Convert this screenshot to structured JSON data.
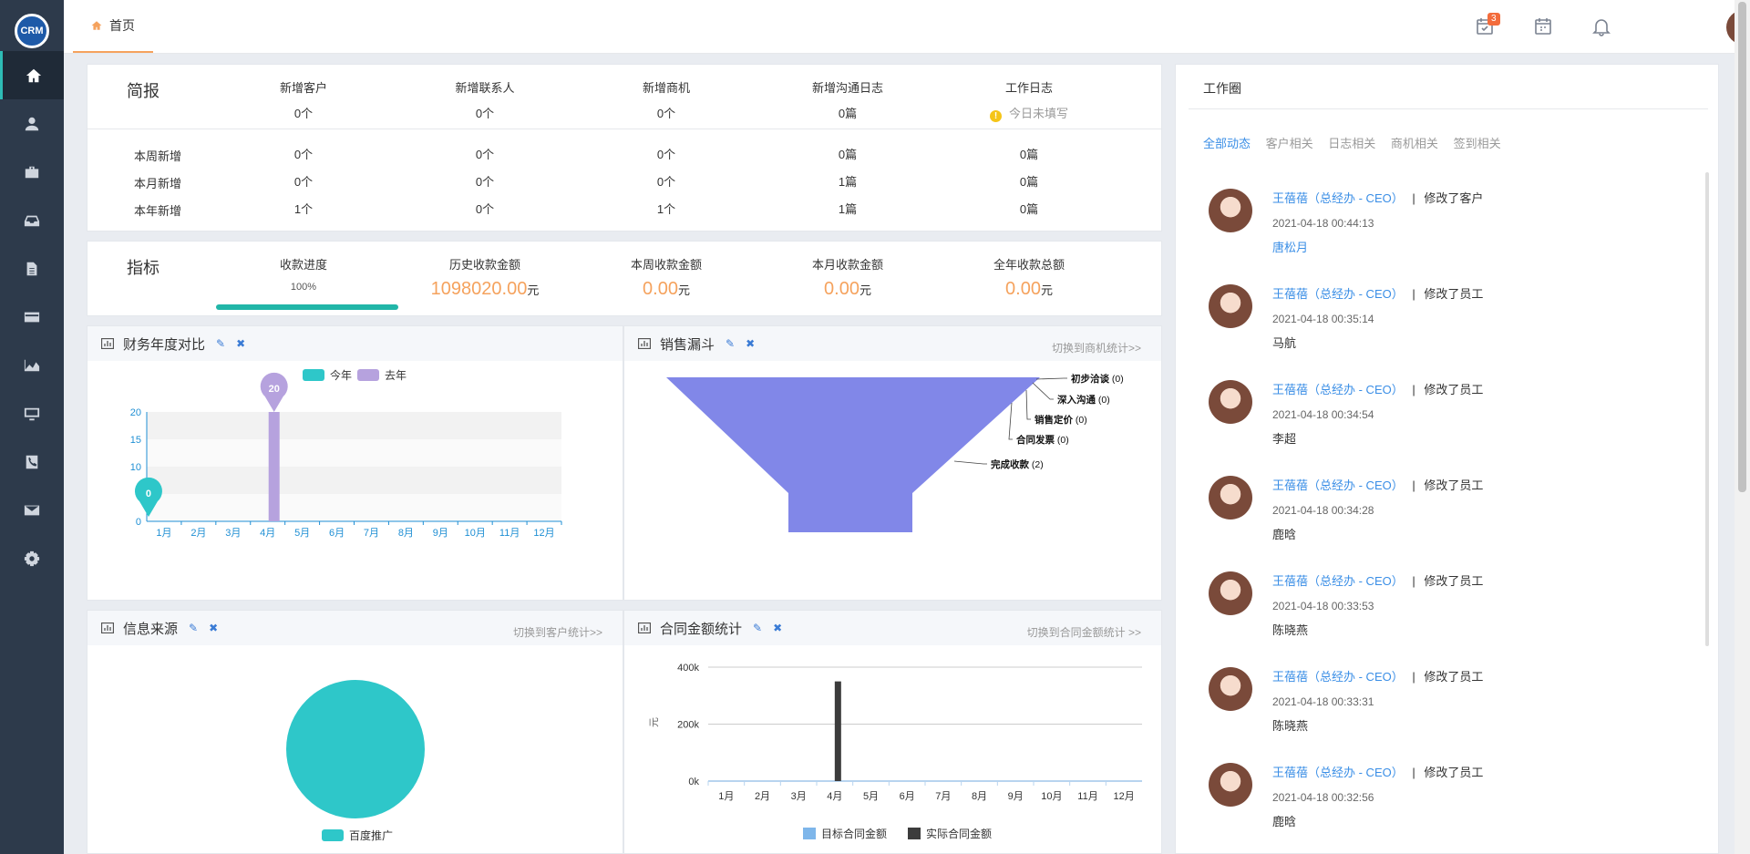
{
  "app": {
    "logo_text": "CRM"
  },
  "nav": {
    "items": [
      {
        "icon": "home-icon"
      },
      {
        "icon": "user-icon"
      },
      {
        "icon": "briefcase-icon"
      },
      {
        "icon": "inbox-icon"
      },
      {
        "icon": "document-icon"
      },
      {
        "icon": "card-icon"
      },
      {
        "icon": "area-chart-icon"
      },
      {
        "icon": "monitor-icon"
      },
      {
        "icon": "phone-icon"
      },
      {
        "icon": "mail-icon"
      },
      {
        "icon": "gear-icon"
      }
    ]
  },
  "topbar": {
    "tab_home": "首页",
    "task_badge": "3"
  },
  "summary": {
    "title": "简报",
    "headers": [
      "新增客户",
      "新增联系人",
      "新增商机",
      "新增沟通日志",
      "工作日志"
    ],
    "today": [
      "0个",
      "0个",
      "0个",
      "0篇"
    ],
    "today_worklog": "今日未填写",
    "rows": [
      {
        "label": "本周新增",
        "values": [
          "0个",
          "0个",
          "0个",
          "0篇",
          "0篇"
        ]
      },
      {
        "label": "本月新增",
        "values": [
          "0个",
          "0个",
          "0个",
          "1篇",
          "0篇"
        ]
      },
      {
        "label": "本年新增",
        "values": [
          "1个",
          "0个",
          "1个",
          "1篇",
          "0篇"
        ]
      }
    ]
  },
  "metrics": {
    "title": "指标",
    "progress_label": "收款进度",
    "progress_text": "100%",
    "progress_value": 1.0,
    "items": [
      {
        "label": "历史收款金额",
        "value": "1098020.00",
        "unit": "元"
      },
      {
        "label": "本周收款金额",
        "value": "0.00",
        "unit": "元"
      },
      {
        "label": "本月收款金额",
        "value": "0.00",
        "unit": "元"
      },
      {
        "label": "全年收款总额",
        "value": "0.00",
        "unit": "元"
      }
    ]
  },
  "finance_chart": {
    "title": "财务年度对比",
    "edit": "✎",
    "close": "✖"
  },
  "funnel_chart": {
    "title": "销售漏斗",
    "edit": "✎",
    "close": "✖",
    "switch": "切换到商机统计>>"
  },
  "source_chart": {
    "title": "信息来源",
    "edit": "✎",
    "close": "✖",
    "switch": "切换到客户统计>>"
  },
  "contract_chart": {
    "title": "合同金额统计",
    "edit": "✎",
    "close": "✖",
    "switch": "切换到合同金额统计 >>"
  },
  "chart_data": [
    {
      "type": "bar",
      "categories": [
        "1月",
        "2月",
        "3月",
        "4月",
        "5月",
        "6月",
        "7月",
        "8月",
        "9月",
        "10月",
        "11月",
        "12月"
      ],
      "series": [
        {
          "name": "今年",
          "values": [
            0,
            0,
            0,
            0,
            0,
            0,
            0,
            0,
            0,
            0,
            0,
            0
          ],
          "color": "#2ec7c9"
        },
        {
          "name": "去年",
          "values": [
            0,
            0,
            0,
            20,
            0,
            0,
            0,
            0,
            0,
            0,
            0,
            0
          ],
          "color": "#b6a2de"
        }
      ],
      "ylim": [
        0,
        20
      ],
      "yticks": [
        "0",
        "5",
        "10",
        "15",
        "20"
      ],
      "markers": [
        "0",
        "20"
      ],
      "legend": "top"
    },
    {
      "type": "funnel",
      "stages": [
        {
          "name": "初步洽谈",
          "value": 0,
          "label": "(0)"
        },
        {
          "name": "深入沟通",
          "value": 0,
          "label": "(0)"
        },
        {
          "name": "销售定价",
          "value": 0,
          "label": "(0)"
        },
        {
          "name": "合同发票",
          "value": 0,
          "label": "(0)"
        },
        {
          "name": "完成收款",
          "value": 2,
          "label": "(2)"
        }
      ],
      "color": "#8187e8"
    },
    {
      "type": "pie",
      "slices": [
        {
          "name": "百度推广",
          "value": 1,
          "color": "#2ec7c9"
        }
      ],
      "legend": "bottom"
    },
    {
      "type": "bar",
      "categories": [
        "1月",
        "2月",
        "3月",
        "4月",
        "5月",
        "6月",
        "7月",
        "8月",
        "9月",
        "10月",
        "11月",
        "12月"
      ],
      "series": [
        {
          "name": "目标合同金额",
          "values": [
            0,
            0,
            0,
            0,
            0,
            0,
            0,
            0,
            0,
            0,
            0,
            0
          ],
          "color": "#7eb6ea"
        },
        {
          "name": "实际合同金额",
          "values": [
            0,
            0,
            0,
            350000,
            0,
            0,
            0,
            0,
            0,
            0,
            0,
            0
          ],
          "color": "#3c3c3c"
        }
      ],
      "ylabel": "元",
      "ylim": [
        0,
        400000
      ],
      "yticks": [
        "0k",
        "200k",
        "400k"
      ],
      "legend": "bottom"
    }
  ],
  "feed": {
    "title": "工作圈",
    "tabs": [
      "全部动态",
      "客户相关",
      "日志相关",
      "商机相关",
      "签到相关"
    ],
    "items": [
      {
        "who": "王蓓蓓（总经办 - CEO）",
        "sep": "|",
        "action": "修改了客户",
        "time": "2021-04-18 00:44:13",
        "target": "唐松月"
      },
      {
        "who": "王蓓蓓（总经办 - CEO）",
        "sep": "|",
        "action": "修改了员工",
        "time": "2021-04-18 00:35:14",
        "target": "马航"
      },
      {
        "who": "王蓓蓓（总经办 - CEO）",
        "sep": "|",
        "action": "修改了员工",
        "time": "2021-04-18 00:34:54",
        "target": "李超"
      },
      {
        "who": "王蓓蓓（总经办 - CEO）",
        "sep": "|",
        "action": "修改了员工",
        "time": "2021-04-18 00:34:28",
        "target": "鹿晗"
      },
      {
        "who": "王蓓蓓（总经办 - CEO）",
        "sep": "|",
        "action": "修改了员工",
        "time": "2021-04-18 00:33:53",
        "target": "陈晓燕"
      },
      {
        "who": "王蓓蓓（总经办 - CEO）",
        "sep": "|",
        "action": "修改了员工",
        "time": "2021-04-18 00:33:31",
        "target": "陈晓燕"
      },
      {
        "who": "王蓓蓓（总经办 - CEO）",
        "sep": "|",
        "action": "修改了员工",
        "time": "2021-04-18 00:32:56",
        "target": "鹿晗"
      }
    ]
  }
}
